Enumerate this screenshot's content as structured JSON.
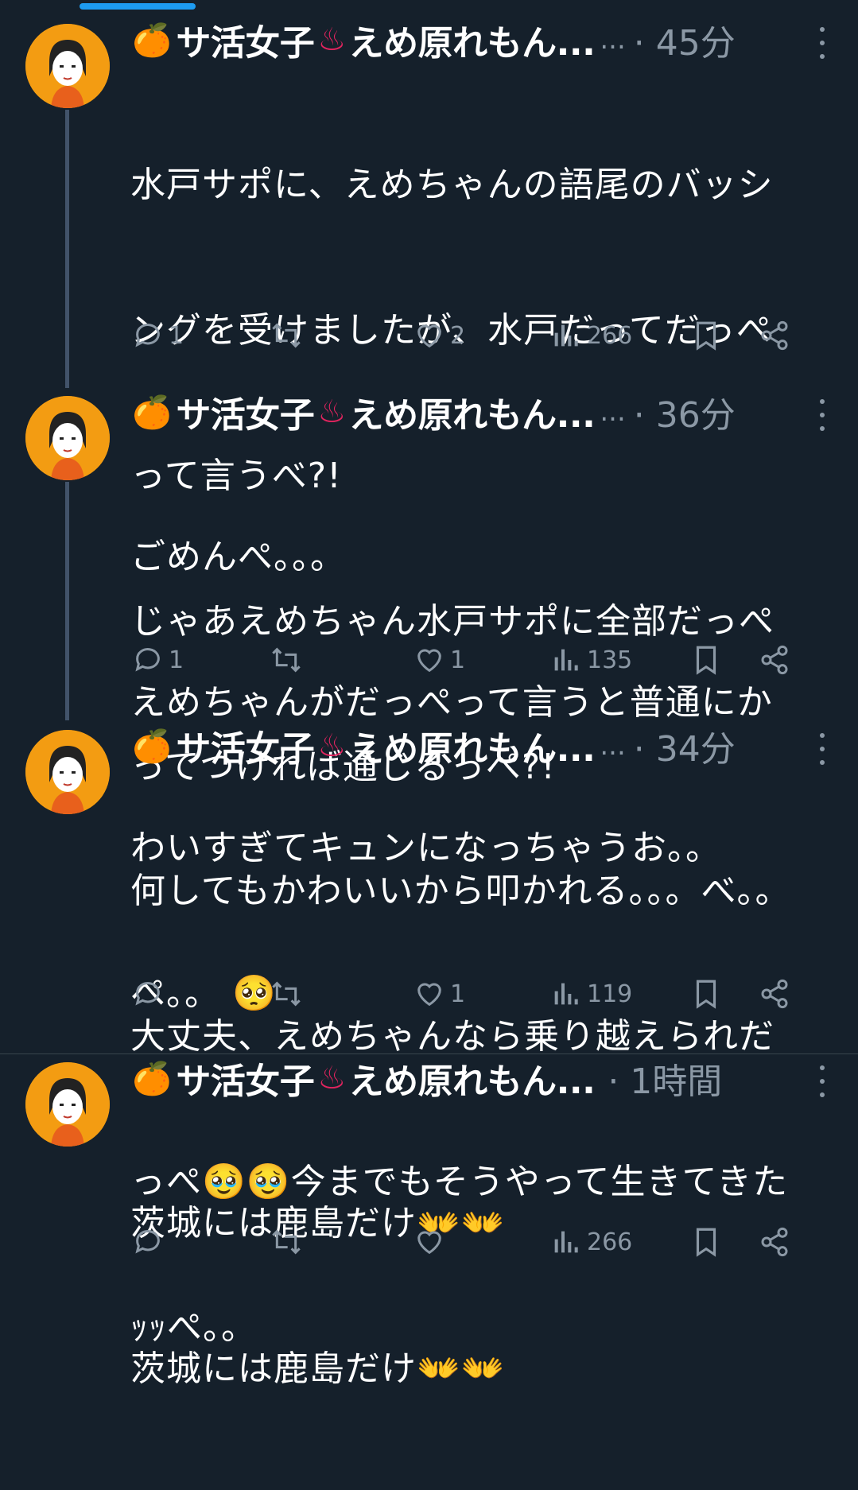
{
  "tweets": [
    {
      "name": "サ活女子",
      "name_suffix": "えめ原れもん...",
      "trunc": "...",
      "time": "· 45分",
      "lines": [
        "水戸サポに、えめちゃんの語尾のバッシ",
        "ングを受けましたが、水戸だってだっぺ",
        "って言うべ?!",
        "じゃあえめちゃん水戸サポに全部だっぺ",
        "ってつければ通じるっぺ?!"
      ],
      "replies": "1",
      "retweets": "",
      "likes": "2",
      "views": "266"
    },
    {
      "name": "サ活女子",
      "name_suffix": "えめ原れもん...",
      "trunc": "...",
      "time": "· 36分",
      "lines": [
        "ごめんぺ。。。",
        "えめちゃんがだっぺって言うと普通にか",
        "わいすぎてキュンになっちゃうお。。",
        "ぺ。。 🥺"
      ],
      "replies": "1",
      "retweets": "",
      "likes": "1",
      "views": "135"
    },
    {
      "name": "サ活女子",
      "name_suffix": "えめ原れもん...",
      "trunc": "...",
      "time": "· 34分",
      "lines": [
        "何してもかわいいから叩かれる。。。べ。。",
        "大丈夫、えめちゃんなら乗り越えられだ",
        "っぺ🥹🥹今までもそうやって生きてきた",
        "ｯｯぺ。。"
      ],
      "replies": "",
      "retweets": "",
      "likes": "1",
      "views": "119"
    },
    {
      "name": "サ活女子",
      "name_suffix": "えめ原れもん...",
      "trunc": "",
      "time": "· 1時間",
      "lines": [
        "茨城には鹿島だけ👐👐",
        "茨城には鹿島だけ👐👐"
      ],
      "replies": "",
      "retweets": "",
      "likes": "",
      "views": "266"
    }
  ],
  "icons": {
    "reply": "reply-icon",
    "retweet": "retweet-icon",
    "like": "like-icon",
    "views": "views-icon",
    "bookmark": "bookmark-icon",
    "share": "share-icon",
    "more": "more-icon"
  },
  "colors": {
    "background": "#15202b",
    "text": "#ffffff",
    "muted": "#8b98a5",
    "accent": "#1d9bf0",
    "thread_line": "#42536a"
  }
}
